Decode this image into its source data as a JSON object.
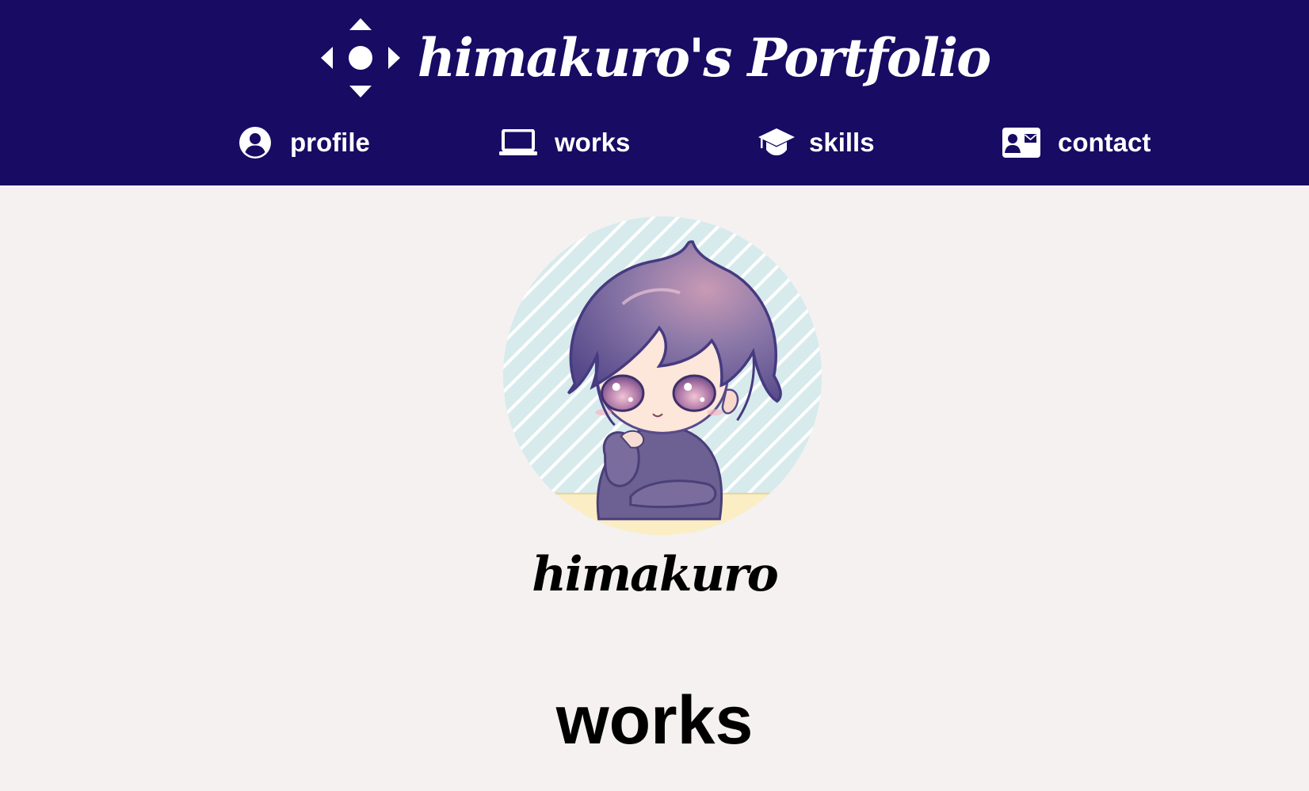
{
  "header": {
    "title": "himakuro's Portfolio",
    "logo_icon": "directional-diamond-icon",
    "background_color": "#170b63",
    "text_color": "#ffffff"
  },
  "nav": {
    "items": [
      {
        "label": "profile",
        "icon": "user-circle-icon"
      },
      {
        "label": "works",
        "icon": "laptop-icon"
      },
      {
        "label": "skills",
        "icon": "graduation-cap-icon"
      },
      {
        "label": "contact",
        "icon": "contact-card-icon"
      }
    ]
  },
  "profile": {
    "avatar_icon": "chibi-character-avatar",
    "name": "himakuro"
  },
  "section": {
    "title": "works"
  },
  "colors": {
    "page_background": "#f4f1f0",
    "avatar_stripe_background": "#d7eaec",
    "avatar_desk": "#fbeec4",
    "avatar_hair": "#6a5898",
    "avatar_hoodie": "#6d6092"
  }
}
